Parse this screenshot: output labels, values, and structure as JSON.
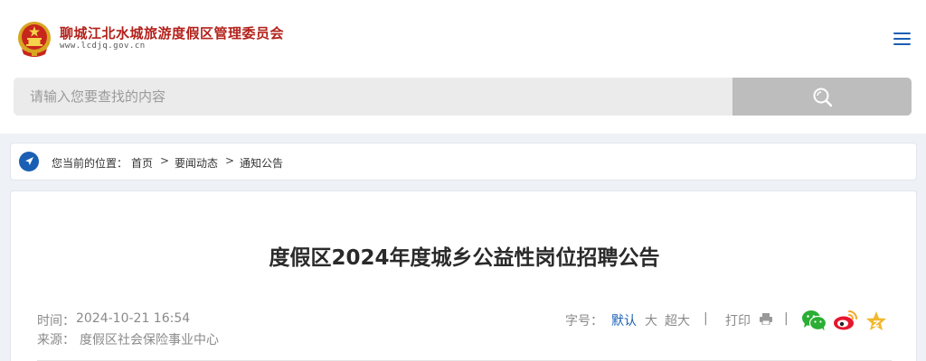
{
  "header": {
    "site_name": "聊城江北水城旅游度假区管理委员会",
    "site_url": "www.lcdjq.gov.cn",
    "search_placeholder": "请输入您要查找的内容"
  },
  "breadcrumb": {
    "prefix": "您当前的位置：",
    "items": [
      "首页",
      "要闻动态",
      "通知公告"
    ],
    "separator": ">"
  },
  "article": {
    "title": "度假区2024年度城乡公益性岗位招聘公告",
    "time_label": "时间：",
    "time_value": "2024-10-21 16:54",
    "source_label": "来源：",
    "source_value": "度假区社会保险事业中心"
  },
  "tools": {
    "font_label": "字号：",
    "font_default": "默认",
    "font_large": "大",
    "font_xlarge": "超大",
    "separator": "|",
    "print_label": "打印"
  },
  "colors": {
    "brand_red": "#b3211b",
    "accent_blue": "#1a5fb4",
    "wechat_green": "#2aae33",
    "weibo_red": "#e6162d",
    "favorite_gold": "#f1b82c"
  },
  "icons": [
    "national-emblem-icon",
    "menu-icon",
    "search-icon",
    "location-icon",
    "print-icon",
    "wechat-icon",
    "weibo-icon",
    "favorite-icon"
  ]
}
